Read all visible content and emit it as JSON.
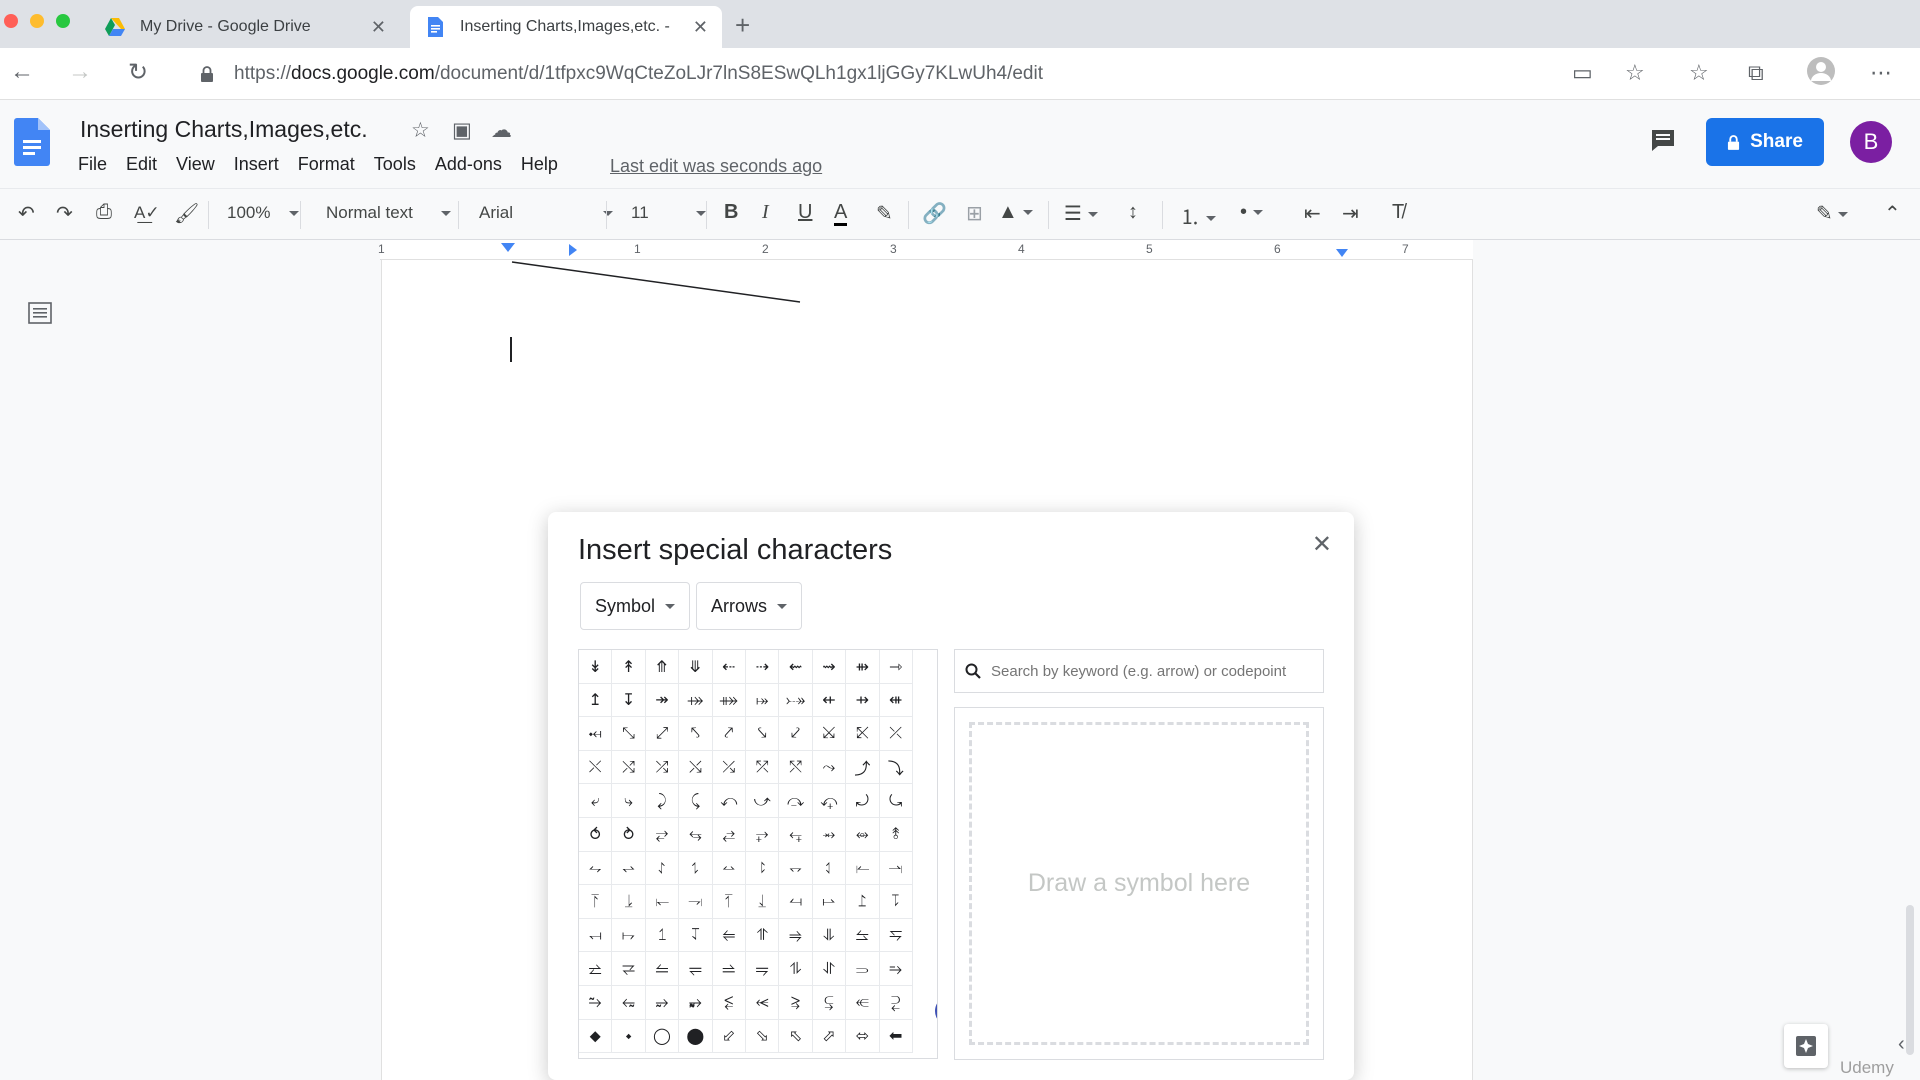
{
  "browser": {
    "tabs": [
      {
        "title": "My Drive - Google Drive",
        "icon": "google-drive-icon"
      },
      {
        "title": "Inserting Charts,Images,etc. -",
        "icon": "google-docs-icon"
      }
    ],
    "url_prefix": "https://",
    "url_host": "docs.google.com",
    "url_path": "/document/d/1tfpxc9WqCteZoLJr7lnS8ESwQLh1gx1ljGGy7KLwUh4/edit"
  },
  "docs": {
    "title": "Inserting Charts,Images,etc.",
    "menu": [
      "File",
      "Edit",
      "View",
      "Insert",
      "Format",
      "Tools",
      "Add-ons",
      "Help"
    ],
    "last_edit": "Last edit was seconds ago",
    "share_label": "Share",
    "avatar_letter": "B"
  },
  "toolbar": {
    "zoom": "100%",
    "style": "Normal text",
    "font": "Arial",
    "size": "11"
  },
  "ruler": {
    "numbers": [
      "1",
      "1",
      "2",
      "3",
      "4",
      "5",
      "6",
      "7"
    ]
  },
  "dialog": {
    "title": "Insert special characters",
    "category": "Symbol",
    "subcategory": "Arrows",
    "search_placeholder": "Search by keyword (e.g. arrow) or codepoint",
    "draw_placeholder": "Draw a symbol here",
    "symbols": [
      "↡",
      "↟",
      "⤊",
      "⤋",
      "⇠",
      "⇢",
      "⇜",
      "⇝",
      "⇻",
      "⇾",
      "↥",
      "↧",
      "↠",
      "⤀",
      "⤁",
      "⤅",
      "⤐",
      "⇷",
      "⇸",
      "⇺",
      "⤟",
      "⤡",
      "⤢",
      "⤣",
      "⤤",
      "⤥",
      "⤦",
      "⤩",
      "⤪",
      "⤫",
      "⤬",
      "⤭",
      "⤮",
      "⤯",
      "⤰",
      "⤱",
      "⤲",
      "⤳",
      "⤴",
      "⤵",
      "⤶",
      "⤷",
      "⤸",
      "⤹",
      "⤺",
      "⤻",
      "⤼",
      "⤽",
      "⤾",
      "⤿",
      "⥀",
      "⥁",
      "⥂",
      "⥃",
      "⥄",
      "⥅",
      "⥆",
      "⥇",
      "⥈",
      "⥉",
      "⥊",
      "⥋",
      "⥌",
      "⥍",
      "⥎",
      "⥏",
      "⥐",
      "⥑",
      "⥒",
      "⥓",
      "⥔",
      "⥕",
      "⥖",
      "⥗",
      "⥘",
      "⥙",
      "⥚",
      "⥛",
      "⥜",
      "⥝",
      "⥞",
      "⥟",
      "⥠",
      "⥡",
      "⥢",
      "⥣",
      "⥤",
      "⥥",
      "⥦",
      "⥧",
      "⥨",
      "⥩",
      "⥪",
      "⥫",
      "⥬",
      "⥭",
      "⥮",
      "⥯",
      "⥰",
      "⥱",
      "⥲",
      "⥳",
      "⥴",
      "⥵",
      "⥶",
      "⥷",
      "⥸",
      "⥹",
      "⥺",
      "⥻",
      "⬥",
      "⬩",
      "◯",
      "⬤",
      "⬃",
      "⬂",
      "⬁",
      "⬀",
      "⬄",
      "⬅"
    ]
  },
  "watermark": "Udemy"
}
